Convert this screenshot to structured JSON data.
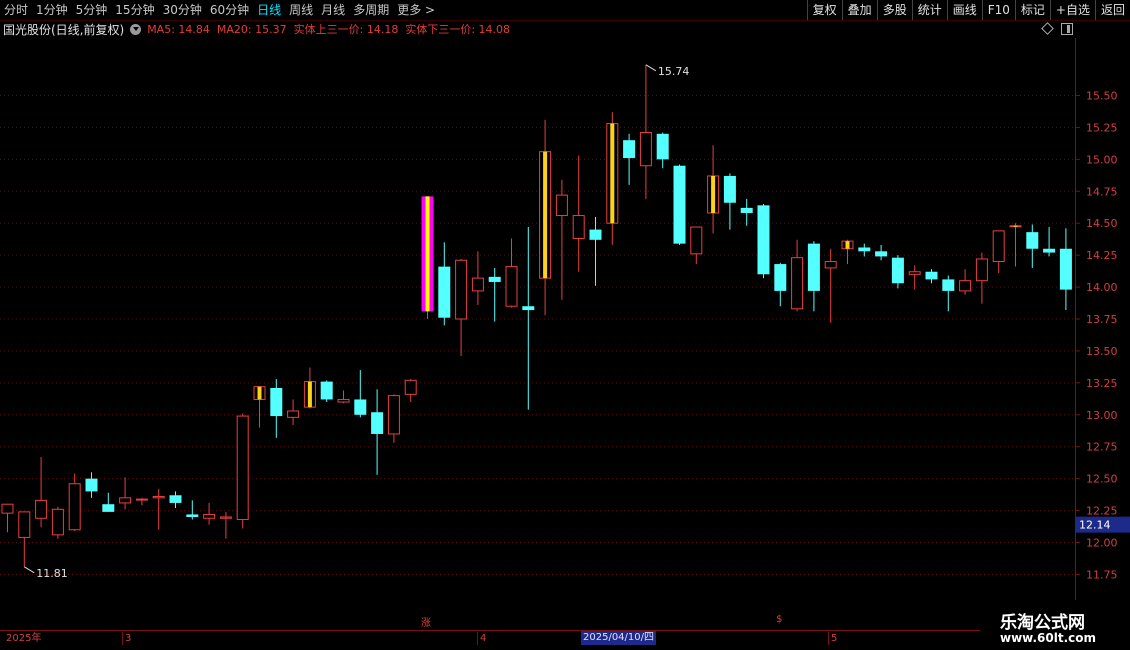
{
  "toolbar": {
    "tabs": [
      {
        "label": "分时",
        "active": false
      },
      {
        "label": "1分钟",
        "active": false
      },
      {
        "label": "5分钟",
        "active": false
      },
      {
        "label": "15分钟",
        "active": false
      },
      {
        "label": "30分钟",
        "active": false
      },
      {
        "label": "60分钟",
        "active": false
      },
      {
        "label": "日线",
        "active": true
      },
      {
        "label": "周线",
        "active": false
      },
      {
        "label": "月线",
        "active": false
      },
      {
        "label": "多周期",
        "active": false
      },
      {
        "label": "更多 >",
        "active": false
      }
    ],
    "right": [
      "复权",
      "叠加",
      "多股",
      "统计",
      "画线",
      "F10",
      "标记",
      "+自选",
      "返回"
    ]
  },
  "info": {
    "title": "国光股份(日线,前复权)",
    "ma5": "MA5: 14.84",
    "ma20": "MA20: 15.37",
    "upper": "实体上三一价: 14.18",
    "lower": "实体下三一价: 14.08"
  },
  "chart_data": {
    "type": "candlestick",
    "ylim": [
      11.55,
      15.95
    ],
    "yticks": [
      "15.50",
      "15.25",
      "15.00",
      "14.75",
      "14.50",
      "14.25",
      "14.00",
      "13.75",
      "13.50",
      "13.25",
      "13.00",
      "12.75",
      "12.50",
      "12.25",
      "12.00",
      "11.75"
    ],
    "last_price": "12.14",
    "high_label": "15.74",
    "low_label": "11.81",
    "candles": [
      {
        "o": 12.23,
        "h": 12.3,
        "l": 12.08,
        "c": 12.3
      },
      {
        "o": 12.04,
        "h": 12.24,
        "l": 11.81,
        "c": 12.24
      },
      {
        "o": 12.19,
        "h": 12.67,
        "l": 12.12,
        "c": 12.33
      },
      {
        "o": 12.06,
        "h": 12.28,
        "l": 12.03,
        "c": 12.26
      },
      {
        "o": 12.1,
        "h": 12.54,
        "l": 12.09,
        "c": 12.46
      },
      {
        "o": 12.5,
        "h": 12.55,
        "l": 12.35,
        "c": 12.4
      },
      {
        "o": 12.3,
        "h": 12.39,
        "l": 12.26,
        "c": 12.24
      },
      {
        "o": 12.31,
        "h": 12.51,
        "l": 12.26,
        "c": 12.35
      },
      {
        "o": 12.34,
        "h": 12.35,
        "l": 12.29,
        "c": 12.34
      },
      {
        "o": 12.35,
        "h": 12.42,
        "l": 12.1,
        "c": 12.36
      },
      {
        "o": 12.37,
        "h": 12.4,
        "l": 12.27,
        "c": 12.31
      },
      {
        "o": 12.22,
        "h": 12.33,
        "l": 12.18,
        "c": 12.2
      },
      {
        "o": 12.19,
        "h": 12.31,
        "l": 12.14,
        "c": 12.22
      },
      {
        "o": 12.19,
        "h": 12.24,
        "l": 12.03,
        "c": 12.2
      },
      {
        "o": 12.18,
        "h": 13.01,
        "l": 12.11,
        "c": 12.99
      },
      {
        "o": 13.12,
        "h": 13.21,
        "l": 12.9,
        "c": 13.22,
        "flag": "yellow"
      },
      {
        "o": 13.21,
        "h": 13.28,
        "l": 12.82,
        "c": 12.99
      },
      {
        "o": 12.98,
        "h": 13.12,
        "l": 12.92,
        "c": 13.03
      },
      {
        "o": 13.06,
        "h": 13.37,
        "l": 13.05,
        "c": 13.26,
        "flag": "yellow"
      },
      {
        "o": 13.26,
        "h": 13.27,
        "l": 13.1,
        "c": 13.12
      },
      {
        "o": 13.1,
        "h": 13.19,
        "l": 13.09,
        "c": 13.12
      },
      {
        "o": 13.12,
        "h": 13.35,
        "l": 12.98,
        "c": 13.0
      },
      {
        "o": 13.02,
        "h": 13.2,
        "l": 12.53,
        "c": 12.85
      },
      {
        "o": 12.85,
        "h": 13.16,
        "l": 12.78,
        "c": 13.15
      },
      {
        "o": 13.16,
        "h": 13.28,
        "l": 13.1,
        "c": 13.27
      },
      {
        "o": 13.81,
        "h": 14.71,
        "l": 13.75,
        "c": 14.71,
        "flag": "magenta"
      },
      {
        "o": 14.16,
        "h": 14.35,
        "l": 13.7,
        "c": 13.76
      },
      {
        "o": 13.75,
        "h": 14.22,
        "l": 13.46,
        "c": 14.21
      },
      {
        "o": 13.97,
        "h": 14.28,
        "l": 13.86,
        "c": 14.07
      },
      {
        "o": 14.08,
        "h": 14.15,
        "l": 13.73,
        "c": 14.04
      },
      {
        "o": 13.85,
        "h": 14.38,
        "l": 13.84,
        "c": 14.16
      },
      {
        "o": 13.85,
        "h": 14.47,
        "l": 13.04,
        "c": 13.82
      },
      {
        "o": 14.07,
        "h": 15.31,
        "l": 13.78,
        "c": 15.06,
        "flag": "yellow"
      },
      {
        "o": 14.56,
        "h": 14.84,
        "l": 13.9,
        "c": 14.72
      },
      {
        "o": 14.38,
        "h": 15.03,
        "l": 14.12,
        "c": 14.56
      },
      {
        "o": 14.45,
        "h": 14.55,
        "l": 14.01,
        "c": 14.37
      },
      {
        "o": 14.5,
        "h": 15.37,
        "l": 14.33,
        "c": 15.28,
        "flag": "yellow"
      },
      {
        "o": 15.15,
        "h": 15.2,
        "l": 14.8,
        "c": 15.01
      },
      {
        "o": 14.95,
        "h": 15.74,
        "l": 14.69,
        "c": 15.21
      },
      {
        "o": 15.2,
        "h": 15.21,
        "l": 14.93,
        "c": 15.0
      },
      {
        "o": 14.95,
        "h": 14.96,
        "l": 14.33,
        "c": 14.34
      },
      {
        "o": 14.26,
        "h": 14.47,
        "l": 14.18,
        "c": 14.47
      },
      {
        "o": 14.58,
        "h": 15.11,
        "l": 14.42,
        "c": 14.87,
        "flag": "yellow"
      },
      {
        "o": 14.87,
        "h": 14.89,
        "l": 14.45,
        "c": 14.66
      },
      {
        "o": 14.62,
        "h": 14.69,
        "l": 14.48,
        "c": 14.58
      },
      {
        "o": 14.64,
        "h": 14.65,
        "l": 14.07,
        "c": 14.1
      },
      {
        "o": 14.18,
        "h": 14.19,
        "l": 13.85,
        "c": 13.97
      },
      {
        "o": 13.83,
        "h": 14.37,
        "l": 13.81,
        "c": 14.23
      },
      {
        "o": 14.34,
        "h": 14.36,
        "l": 13.81,
        "c": 13.97
      },
      {
        "o": 14.15,
        "h": 14.3,
        "l": 13.72,
        "c": 14.2
      },
      {
        "o": 14.3,
        "h": 14.37,
        "l": 14.18,
        "c": 14.36,
        "flag": "yellow"
      },
      {
        "o": 14.31,
        "h": 14.34,
        "l": 14.24,
        "c": 14.28
      },
      {
        "o": 14.28,
        "h": 14.33,
        "l": 14.21,
        "c": 14.24
      },
      {
        "o": 14.23,
        "h": 14.25,
        "l": 13.99,
        "c": 14.03
      },
      {
        "o": 14.1,
        "h": 14.17,
        "l": 13.98,
        "c": 14.12
      },
      {
        "o": 14.12,
        "h": 14.14,
        "l": 14.03,
        "c": 14.06
      },
      {
        "o": 14.06,
        "h": 14.09,
        "l": 13.81,
        "c": 13.97
      },
      {
        "o": 13.97,
        "h": 14.14,
        "l": 13.94,
        "c": 14.05
      },
      {
        "o": 14.05,
        "h": 14.27,
        "l": 13.87,
        "c": 14.22
      },
      {
        "o": 14.2,
        "h": 14.44,
        "l": 14.11,
        "c": 14.44
      },
      {
        "o": 14.48,
        "h": 14.5,
        "l": 14.16,
        "c": 14.48,
        "flag": "yellow"
      },
      {
        "o": 14.43,
        "h": 14.49,
        "l": 14.15,
        "c": 14.3
      },
      {
        "o": 14.3,
        "h": 14.47,
        "l": 14.24,
        "c": 14.27
      },
      {
        "o": 14.3,
        "h": 14.46,
        "l": 13.82,
        "c": 13.98
      }
    ]
  },
  "xaxis": {
    "labels": [
      "2025年",
      "3",
      "4",
      "5"
    ],
    "date_box": "2025/04/10/四",
    "marks": [
      "涨",
      "$"
    ]
  },
  "watermark": {
    "name": "乐淘公式网",
    "url": "www.60lt.com"
  }
}
